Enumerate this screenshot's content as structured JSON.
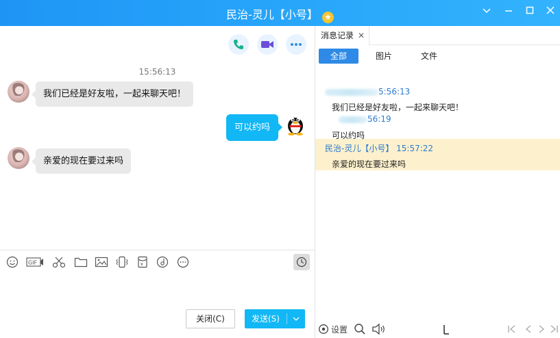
{
  "window": {
    "title": "民治-灵儿【小号】",
    "star_glyph": "★",
    "controls": {
      "dropdown": "∨",
      "minimize": "—",
      "maximize": "□",
      "close": "✕"
    }
  },
  "colors": {
    "titlebar": "#1e95f5",
    "accent": "#12b7f5",
    "tab_active": "#2e8ae6",
    "highlight": "#fdf1cd"
  },
  "chat": {
    "timestamp": "15:56:13",
    "messages": [
      {
        "from": "contact",
        "text": "我们已经是好友啦，一起来聊天吧！"
      },
      {
        "from": "me",
        "text": "可以约吗"
      },
      {
        "from": "contact",
        "text": "亲爱的现在要过来吗"
      }
    ],
    "actions": [
      "phone-icon",
      "video-icon",
      "more-icon"
    ]
  },
  "toolbar": {
    "icons": [
      "emoji-icon",
      "gif-icon",
      "scissors-icon",
      "folder-icon",
      "image-icon",
      "shake-icon",
      "red-packet-icon",
      "music-icon",
      "more-tools-icon"
    ],
    "gif_label": "GIF",
    "history_icon": "clock-icon"
  },
  "buttons": {
    "close": "关闭(C)",
    "send": "发送(S)"
  },
  "history": {
    "tab_label": "消息记录",
    "tab_close": "✕",
    "filters": [
      "全部",
      "图片",
      "文件"
    ],
    "entries": [
      {
        "meta": "5:56:13",
        "text": "我们已经是好友啦，一起来聊天吧！"
      },
      {
        "meta": "56:19",
        "text": "可以约吗"
      },
      {
        "meta": "民治-灵儿【小号】 15:57:22",
        "text": "亲爱的现在要过来吗"
      }
    ],
    "bottom": {
      "settings": "设置"
    }
  }
}
